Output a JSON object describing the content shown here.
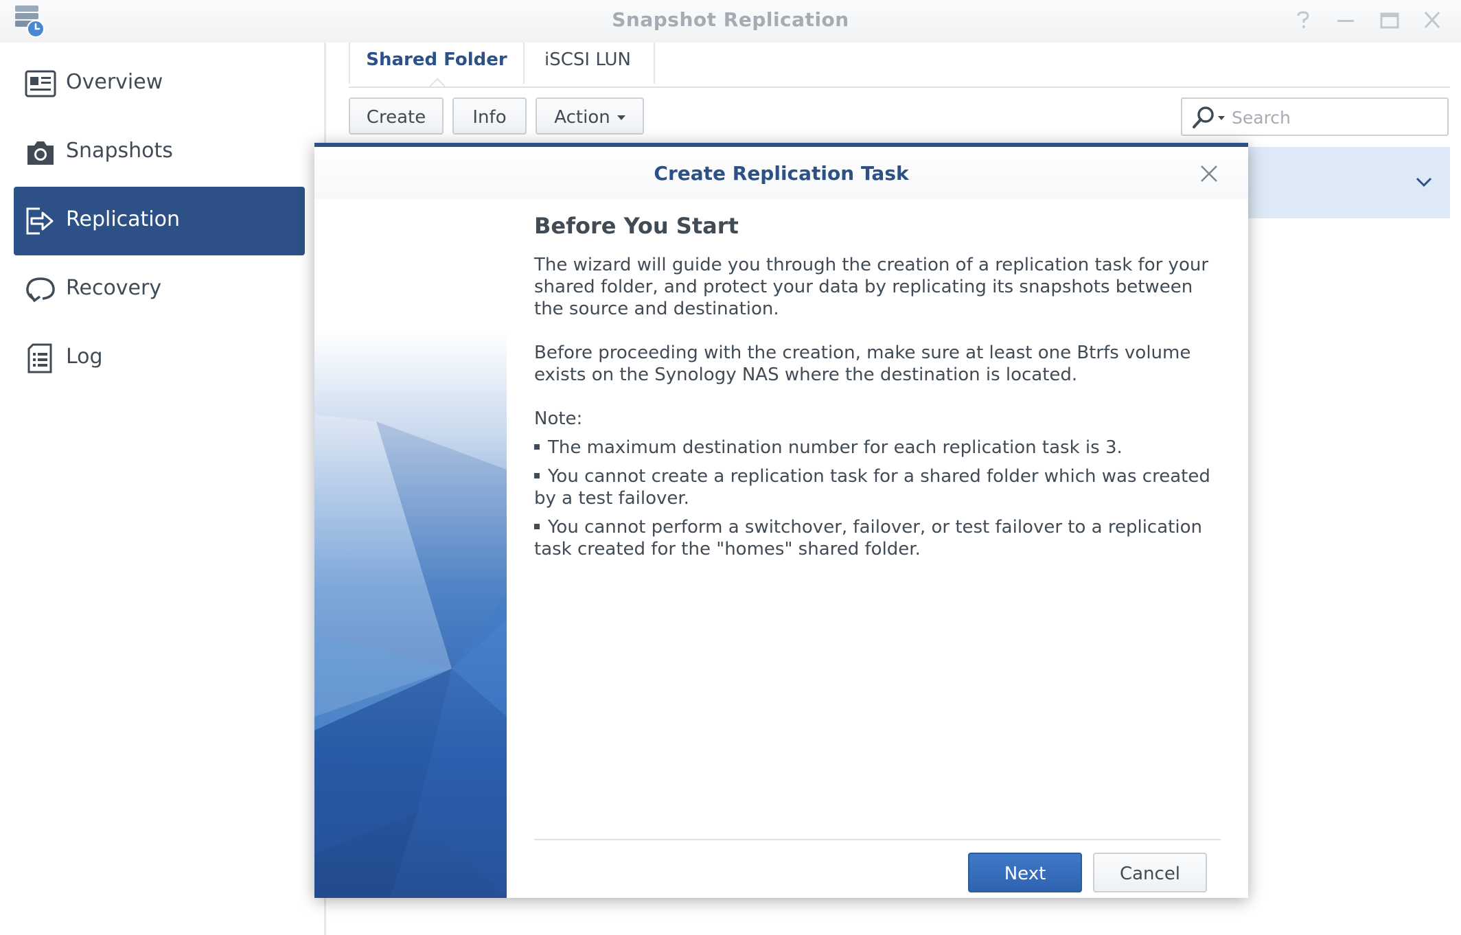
{
  "window": {
    "title": "Snapshot Replication",
    "app_icon": "snapshot-replication-app-icon",
    "controls": [
      "help-icon",
      "minimize-icon",
      "maximize-icon",
      "close-icon"
    ]
  },
  "sidebar": {
    "active_index": 2,
    "items": [
      {
        "label": "Overview",
        "icon": "overview-icon"
      },
      {
        "label": "Snapshots",
        "icon": "camera-icon"
      },
      {
        "label": "Replication",
        "icon": "replication-icon"
      },
      {
        "label": "Recovery",
        "icon": "recovery-icon"
      },
      {
        "label": "Log",
        "icon": "log-icon"
      }
    ]
  },
  "main": {
    "tabs": [
      {
        "label": "Shared Folder",
        "active": true
      },
      {
        "label": "iSCSI LUN",
        "active": false
      }
    ],
    "toolbar": {
      "create_label": "Create",
      "info_label": "Info",
      "action_label": "Action"
    },
    "search": {
      "placeholder": "Search"
    }
  },
  "dialog": {
    "title": "Create Replication Task",
    "heading": "Before You Start",
    "paragraph1": "The wizard will guide you through the creation of a replication task for your shared folder, and protect your data by replicating its snapshots between the source and destination.",
    "paragraph2": "Before proceeding with the creation, make sure at least one Btrfs volume exists on the Synology NAS where the destination is located.",
    "note_label": "Note:",
    "notes": [
      "The maximum destination number for each replication task is 3.",
      "You cannot create a replication task for a shared folder which was created by a test failover.",
      "You cannot perform a switchover, failover, or test failover to a replication task created for the \"homes\" shared folder."
    ],
    "next_label": "Next",
    "cancel_label": "Cancel"
  },
  "colors": {
    "accent": "#2d5186",
    "primary_button": "#3a72bf",
    "selected_row": "#dde9f6",
    "text": "#414b55",
    "muted_text": "#a4abb3"
  }
}
